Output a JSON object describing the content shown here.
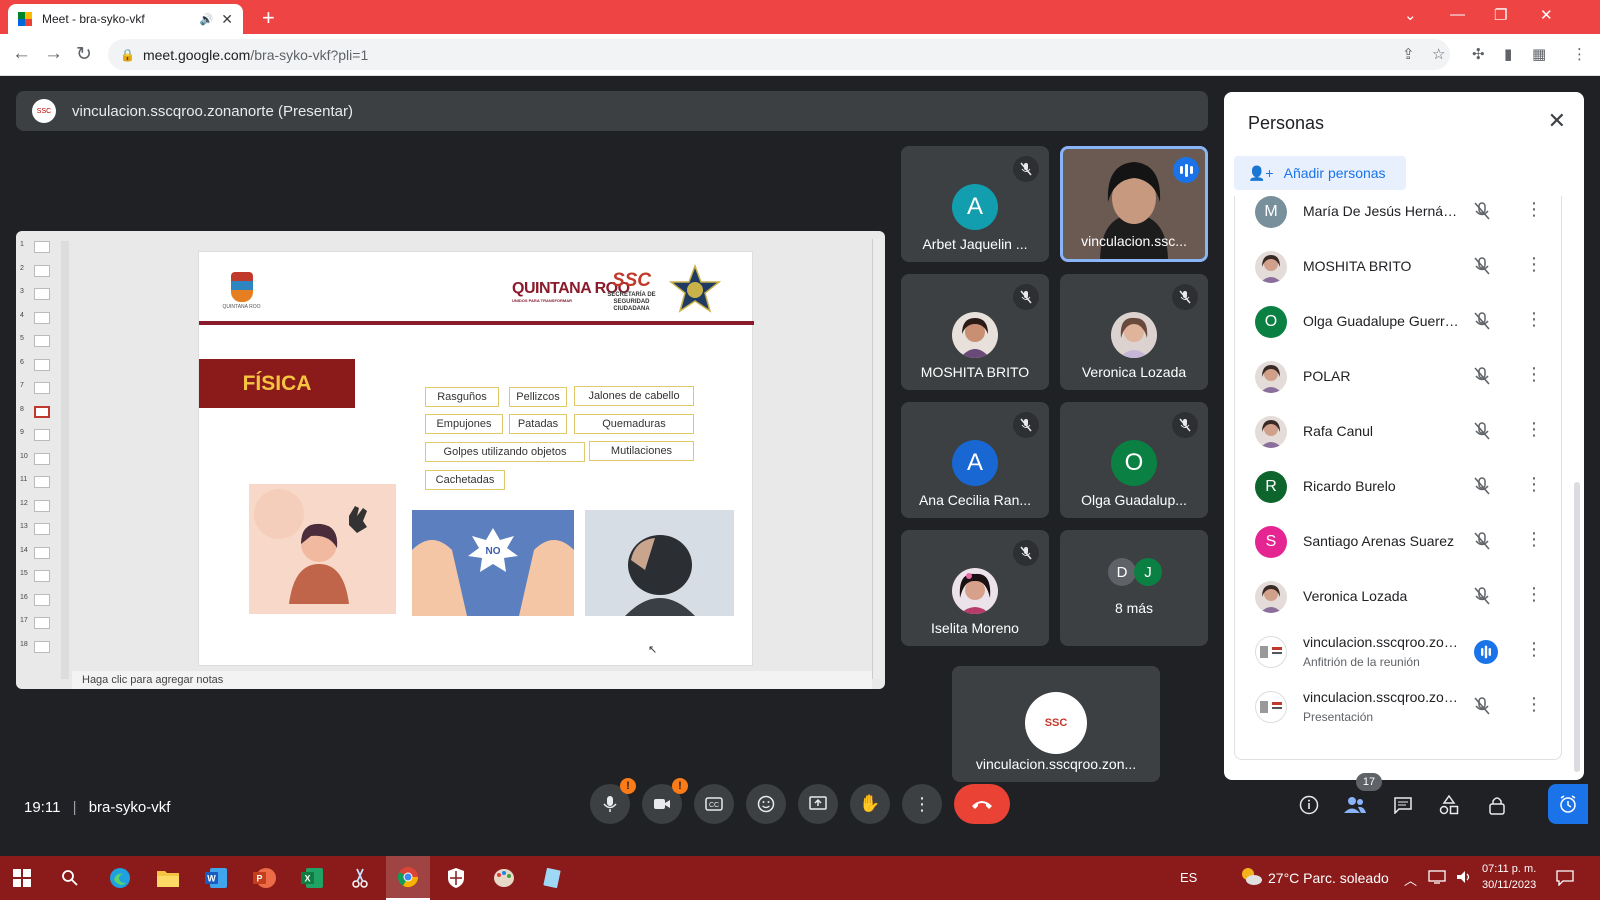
{
  "browser": {
    "tab_title": "Meet - bra-syko-vkf",
    "url_host": "meet.google.com",
    "url_path": "/bra-syko-vkf?pli=1"
  },
  "presentation_bar": {
    "text": "vinculacion.sscqroo.zonanorte (Presentar)"
  },
  "slide": {
    "title": "FÍSICA",
    "logo_left_caption": "QUINTANA ROO",
    "logo_qroo": "QUINTANA ROO",
    "logo_qroo_tag": "UNIDOS PARA TRANSFORMAR",
    "logo_ssc": "SSC",
    "logo_ssc_sub": "SECRETARÍA DE SEGURIDAD CIUDADANA",
    "labels": [
      "Rasguños",
      "Pellizcos",
      "Jalones de cabello",
      "Empujones",
      "Patadas",
      "Quemaduras",
      "Golpes utilizando objetos",
      "Mutilaciones",
      "Cachetadas"
    ],
    "image2_text": "NO",
    "notes_placeholder": "Haga clic para agregar notas",
    "thumb_numbers": [
      "1",
      "2",
      "3",
      "4",
      "5",
      "6",
      "7",
      "8",
      "9",
      "10",
      "11",
      "12",
      "13",
      "14",
      "15",
      "16",
      "17",
      "18"
    ],
    "active_thumb": 8
  },
  "tiles": [
    {
      "name": "Arbet Jaquelin ...",
      "initial": "A",
      "color": "#129eaf",
      "muted": true
    },
    {
      "name": "vinculacion.ssc...",
      "speaking": true
    },
    {
      "name": "MOSHITA BRITO",
      "muted": true
    },
    {
      "name": "Veronica Lozada",
      "muted": true
    },
    {
      "name": "Ana Cecilia Ran...",
      "initial": "A",
      "color": "#1967d2",
      "muted": true
    },
    {
      "name": "Olga Guadalup...",
      "initial": "O",
      "color": "#0b8043",
      "muted": true
    },
    {
      "name": "Iselita Moreno",
      "muted": true
    },
    {
      "name": "8 más",
      "initials": [
        "D",
        "J"
      ],
      "colors": [
        "#5f6368",
        "#0b8043"
      ]
    },
    {
      "name": "vinculacion.sscqroo.zon..."
    }
  ],
  "people_panel": {
    "title": "Personas",
    "add_label": "Añadir personas",
    "participants": [
      {
        "name": "María De Jesús Hernánd...",
        "initial": "M",
        "color": "#78909c"
      },
      {
        "name": "MOSHITA BRITO",
        "photo": true
      },
      {
        "name": "Olga Guadalupe Guerre...",
        "initial": "O",
        "color": "#0b8043"
      },
      {
        "name": "POLAR",
        "photo": true
      },
      {
        "name": "Rafa Canul",
        "photo": true
      },
      {
        "name": "Ricardo Burelo",
        "initial": "R",
        "color": "#0d652d"
      },
      {
        "name": "Santiago Arenas Suarez",
        "initial": "S",
        "color": "#e52592"
      },
      {
        "name": "Veronica Lozada",
        "photo": true
      },
      {
        "name": "vinculacion.sscqroo.zon...",
        "sub": "Anfitrión de la reunión",
        "logo": true,
        "speaking": true
      },
      {
        "name": "vinculacion.sscqroo.zon...",
        "sub": "Presentación",
        "logo": true
      }
    ]
  },
  "bottom_bar": {
    "time": "19:11",
    "meeting_code": "bra-syko-vkf",
    "participant_count": "17",
    "warn_glyph": "!"
  },
  "taskbar": {
    "lang": "ES",
    "weather": "27°C  Parc. soleado",
    "clock_time": "07:11 p. m.",
    "clock_date": "30/11/2023"
  },
  "colors": {
    "meet_bg": "#202124",
    "tile_bg": "#3c4043",
    "accent": "#1a73e8",
    "hangup": "#ea4335",
    "tabstrip": "#ef4444",
    "taskbar": "#8b1a1a"
  }
}
